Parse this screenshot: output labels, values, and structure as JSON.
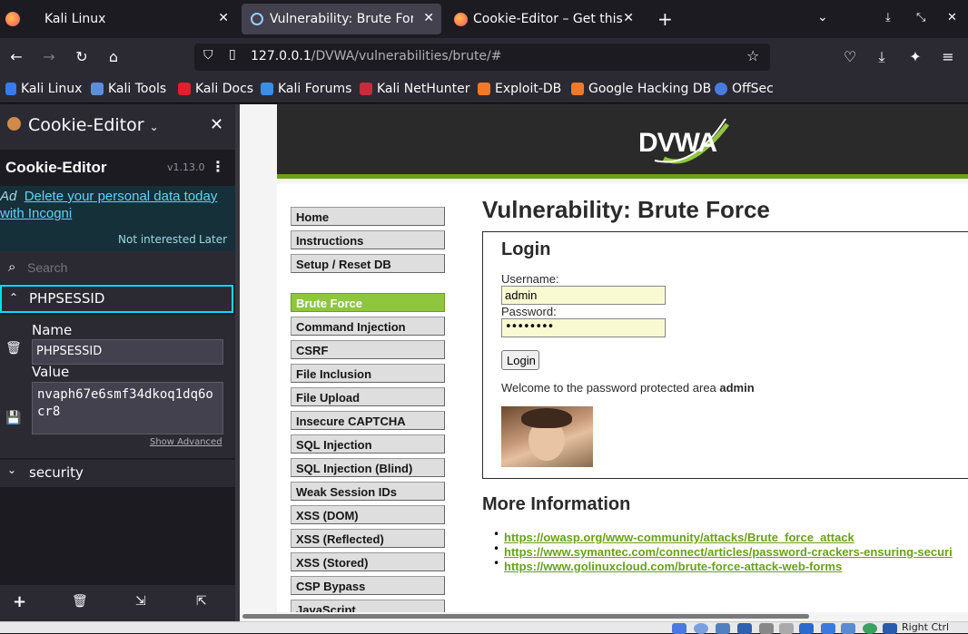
{
  "browser": {
    "tabs": [
      {
        "title": "Kali Linux",
        "active": false
      },
      {
        "title": "Vulnerability: Brute Force",
        "active": true
      },
      {
        "title": "Cookie-Editor – Get this E",
        "active": false
      }
    ],
    "url_host": "127.0.0.1",
    "url_path": "/DVWA/vulnerabilities/brute/#",
    "bookmarks": [
      "Kali Linux",
      "Kali Tools",
      "Kali Docs",
      "Kali Forums",
      "Kali NetHunter",
      "Exploit-DB",
      "Google Hacking DB",
      "OffSec"
    ]
  },
  "cookie_editor": {
    "header_title": "Cookie-Editor",
    "app_title": "Cookie-Editor",
    "version": "v1.13.0",
    "ad_label": "Ad",
    "ad_text": "Delete your personal data today with Incogni",
    "not_interested": "Not interested",
    "later": "Later",
    "search_placeholder": "Search",
    "cookies": [
      {
        "name": "PHPSESSID",
        "expanded": true
      },
      {
        "name": "security",
        "expanded": false
      }
    ],
    "field_name_label": "Name",
    "field_name_value": "PHPSESSID",
    "field_value_label": "Value",
    "field_value_value": "nvaph67e6smf34dkoq1dq6ocr8",
    "show_advanced": "Show Advanced"
  },
  "dvwa": {
    "logo": "DVWA",
    "menu_top": [
      "Home",
      "Instructions",
      "Setup / Reset DB"
    ],
    "menu_vulns": [
      "Brute Force",
      "Command Injection",
      "CSRF",
      "File Inclusion",
      "File Upload",
      "Insecure CAPTCHA",
      "SQL Injection",
      "SQL Injection (Blind)",
      "Weak Session IDs",
      "XSS (DOM)",
      "XSS (Reflected)",
      "XSS (Stored)",
      "CSP Bypass",
      "JavaScript"
    ],
    "page_title": "Vulnerability: Brute Force",
    "login_heading": "Login",
    "username_label": "Username:",
    "username_value": "admin",
    "password_label": "Password:",
    "password_value": "••••••••",
    "login_button": "Login",
    "welcome_text": "Welcome to the password protected area ",
    "welcome_user": "admin",
    "more_info_heading": "More Information",
    "links": [
      "https://owasp.org/www-community/attacks/Brute_force_attack",
      "https://www.symantec.com/connect/articles/password-crackers-ensuring-securi",
      "https://www.golinuxcloud.com/brute-force-attack-web-forms"
    ]
  },
  "taskbar": {
    "label": "Right Ctrl"
  },
  "colors": {
    "dvwa_green": "#8ec63f",
    "dark_bg": "#1c1b22",
    "toolbar_bg": "#2b2a33",
    "accent_blue": "#00ddff"
  }
}
